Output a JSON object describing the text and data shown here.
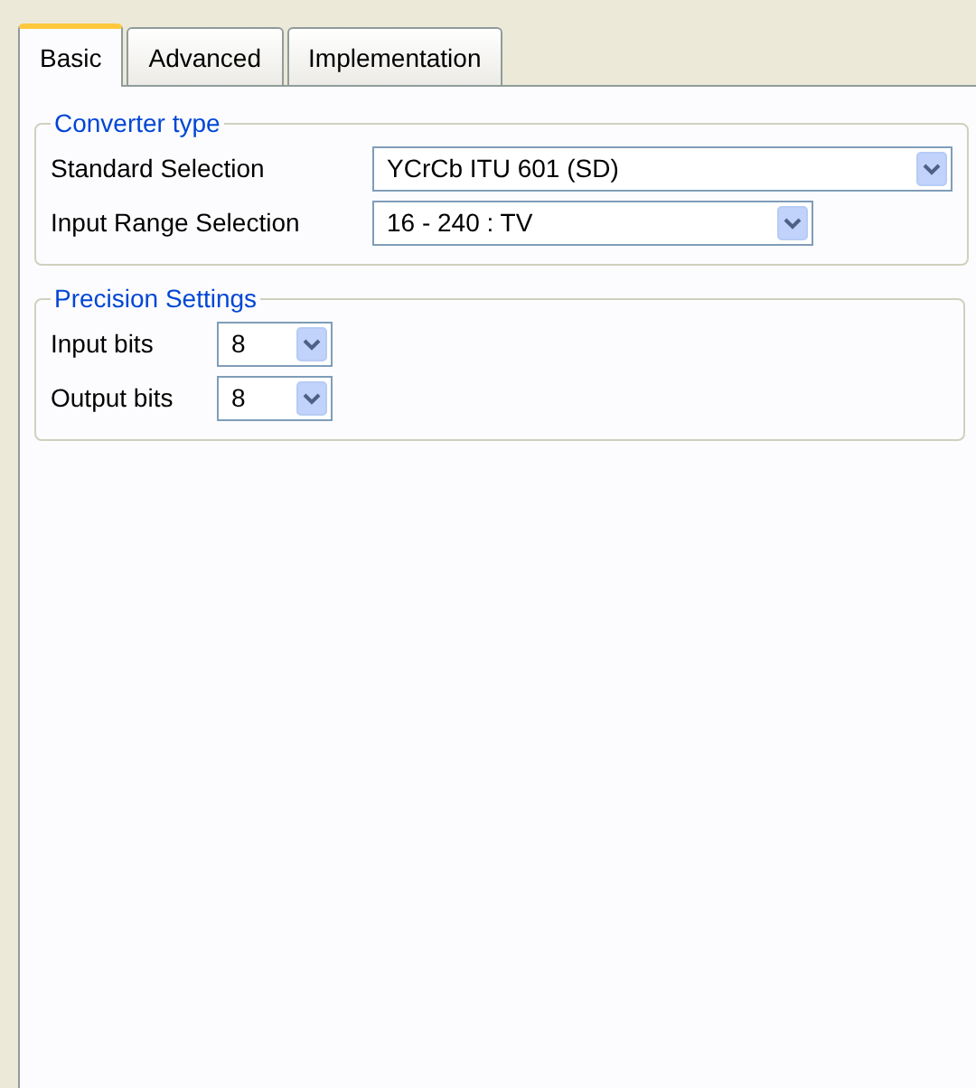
{
  "tabs": [
    {
      "label": "Basic",
      "selected": true
    },
    {
      "label": "Advanced",
      "selected": false
    },
    {
      "label": "Implementation",
      "selected": false
    }
  ],
  "groups": [
    {
      "title": "Converter type",
      "fields": [
        {
          "label": "Standard Selection",
          "value": "YCrCb ITU 601 (SD)"
        },
        {
          "label": "Input Range Selection",
          "value": "16 - 240 : TV"
        }
      ]
    },
    {
      "title": "Precision Settings",
      "fields": [
        {
          "label": "Input bits",
          "value": "8"
        },
        {
          "label": "Output bits",
          "value": "8"
        }
      ]
    }
  ]
}
